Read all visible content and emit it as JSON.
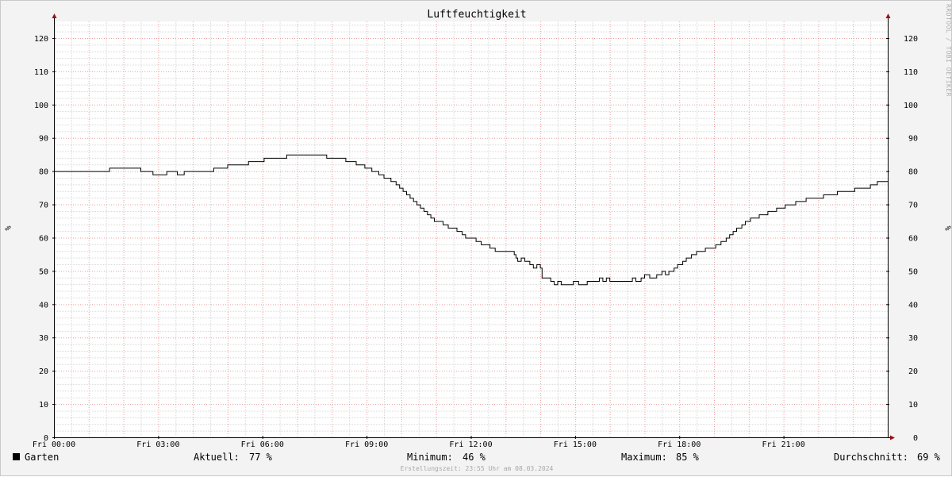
{
  "chart_data": {
    "type": "line",
    "title": "Luftfeuchtigkeit",
    "ylabel": "%",
    "ylabel_right": "%",
    "ylim": [
      0,
      125
    ],
    "yticks": [
      0,
      10,
      20,
      30,
      40,
      50,
      60,
      70,
      80,
      90,
      100,
      110,
      120
    ],
    "xlim": [
      0,
      24
    ],
    "xticks": [
      {
        "hour": 0,
        "label": "Fri 00:00"
      },
      {
        "hour": 3,
        "label": "Fri 03:00"
      },
      {
        "hour": 6,
        "label": "Fri 06:00"
      },
      {
        "hour": 9,
        "label": "Fri 09:00"
      },
      {
        "hour": 12,
        "label": "Fri 12:00"
      },
      {
        "hour": 15,
        "label": "Fri 15:00"
      },
      {
        "hour": 18,
        "label": "Fri 18:00"
      },
      {
        "hour": 21,
        "label": "Fri 21:00"
      }
    ],
    "grid": true,
    "series": [
      {
        "name": "Garten",
        "color": "#000000",
        "points": [
          [
            0.0,
            80
          ],
          [
            1.6,
            81
          ],
          [
            2.5,
            80
          ],
          [
            2.85,
            79
          ],
          [
            3.25,
            80
          ],
          [
            3.55,
            79
          ],
          [
            3.75,
            80
          ],
          [
            4.6,
            81
          ],
          [
            5.0,
            82
          ],
          [
            5.6,
            83
          ],
          [
            6.05,
            84
          ],
          [
            6.7,
            85
          ],
          [
            7.85,
            84
          ],
          [
            8.4,
            83
          ],
          [
            8.7,
            82
          ],
          [
            8.95,
            81
          ],
          [
            9.15,
            80
          ],
          [
            9.35,
            79
          ],
          [
            9.5,
            78
          ],
          [
            9.7,
            77
          ],
          [
            9.85,
            76
          ],
          [
            9.95,
            75
          ],
          [
            10.05,
            74
          ],
          [
            10.15,
            73
          ],
          [
            10.25,
            72
          ],
          [
            10.35,
            71
          ],
          [
            10.45,
            70
          ],
          [
            10.55,
            69
          ],
          [
            10.65,
            68
          ],
          [
            10.75,
            67
          ],
          [
            10.85,
            66
          ],
          [
            10.95,
            65
          ],
          [
            11.2,
            64
          ],
          [
            11.35,
            63
          ],
          [
            11.6,
            62
          ],
          [
            11.75,
            61
          ],
          [
            11.85,
            60
          ],
          [
            12.15,
            59
          ],
          [
            12.3,
            58
          ],
          [
            12.55,
            57
          ],
          [
            12.7,
            56
          ],
          [
            13.25,
            55
          ],
          [
            13.3,
            54
          ],
          [
            13.35,
            53
          ],
          [
            13.45,
            54
          ],
          [
            13.55,
            53
          ],
          [
            13.7,
            52
          ],
          [
            13.8,
            51
          ],
          [
            13.9,
            52
          ],
          [
            14.0,
            51
          ],
          [
            14.05,
            48
          ],
          [
            14.3,
            47
          ],
          [
            14.4,
            46
          ],
          [
            14.5,
            47
          ],
          [
            14.6,
            46
          ],
          [
            14.95,
            47
          ],
          [
            15.1,
            46
          ],
          [
            15.35,
            47
          ],
          [
            15.6,
            47
          ],
          [
            15.7,
            48
          ],
          [
            15.8,
            47
          ],
          [
            15.9,
            48
          ],
          [
            16.0,
            47
          ],
          [
            16.55,
            47
          ],
          [
            16.65,
            48
          ],
          [
            16.75,
            47
          ],
          [
            16.9,
            48
          ],
          [
            17.0,
            49
          ],
          [
            17.15,
            48
          ],
          [
            17.35,
            49
          ],
          [
            17.5,
            50
          ],
          [
            17.6,
            49
          ],
          [
            17.7,
            50
          ],
          [
            17.85,
            51
          ],
          [
            17.95,
            52
          ],
          [
            18.1,
            53
          ],
          [
            18.2,
            54
          ],
          [
            18.35,
            55
          ],
          [
            18.5,
            56
          ],
          [
            18.75,
            57
          ],
          [
            19.05,
            58
          ],
          [
            19.2,
            59
          ],
          [
            19.35,
            60
          ],
          [
            19.45,
            61
          ],
          [
            19.55,
            62
          ],
          [
            19.65,
            63
          ],
          [
            19.8,
            64
          ],
          [
            19.9,
            65
          ],
          [
            20.05,
            66
          ],
          [
            20.3,
            67
          ],
          [
            20.55,
            68
          ],
          [
            20.8,
            69
          ],
          [
            21.05,
            70
          ],
          [
            21.35,
            71
          ],
          [
            21.65,
            72
          ],
          [
            22.15,
            73
          ],
          [
            22.55,
            74
          ],
          [
            23.05,
            75
          ],
          [
            23.5,
            76
          ],
          [
            23.7,
            77
          ],
          [
            24.0,
            77
          ]
        ]
      }
    ]
  },
  "watermark": "RRDTOOL / TOBI OETIKER",
  "legend": {
    "series_name": "Garten",
    "current_label": "Aktuell:",
    "current_value": "77 %",
    "min_label": "Minimum:",
    "min_value": "46 %",
    "max_label": "Maximum:",
    "max_value": "85 %",
    "avg_label": "Durchschnitt:",
    "avg_value": "69 %"
  },
  "footer": "Erstellungszeit: 23:55 Uhr am 08.03.2024",
  "colors": {
    "minor_grid": "#d8d8d8",
    "major_grid": "#e8a0a0",
    "axis": "#000000",
    "arrow": "#a01010",
    "line": "#000000"
  }
}
